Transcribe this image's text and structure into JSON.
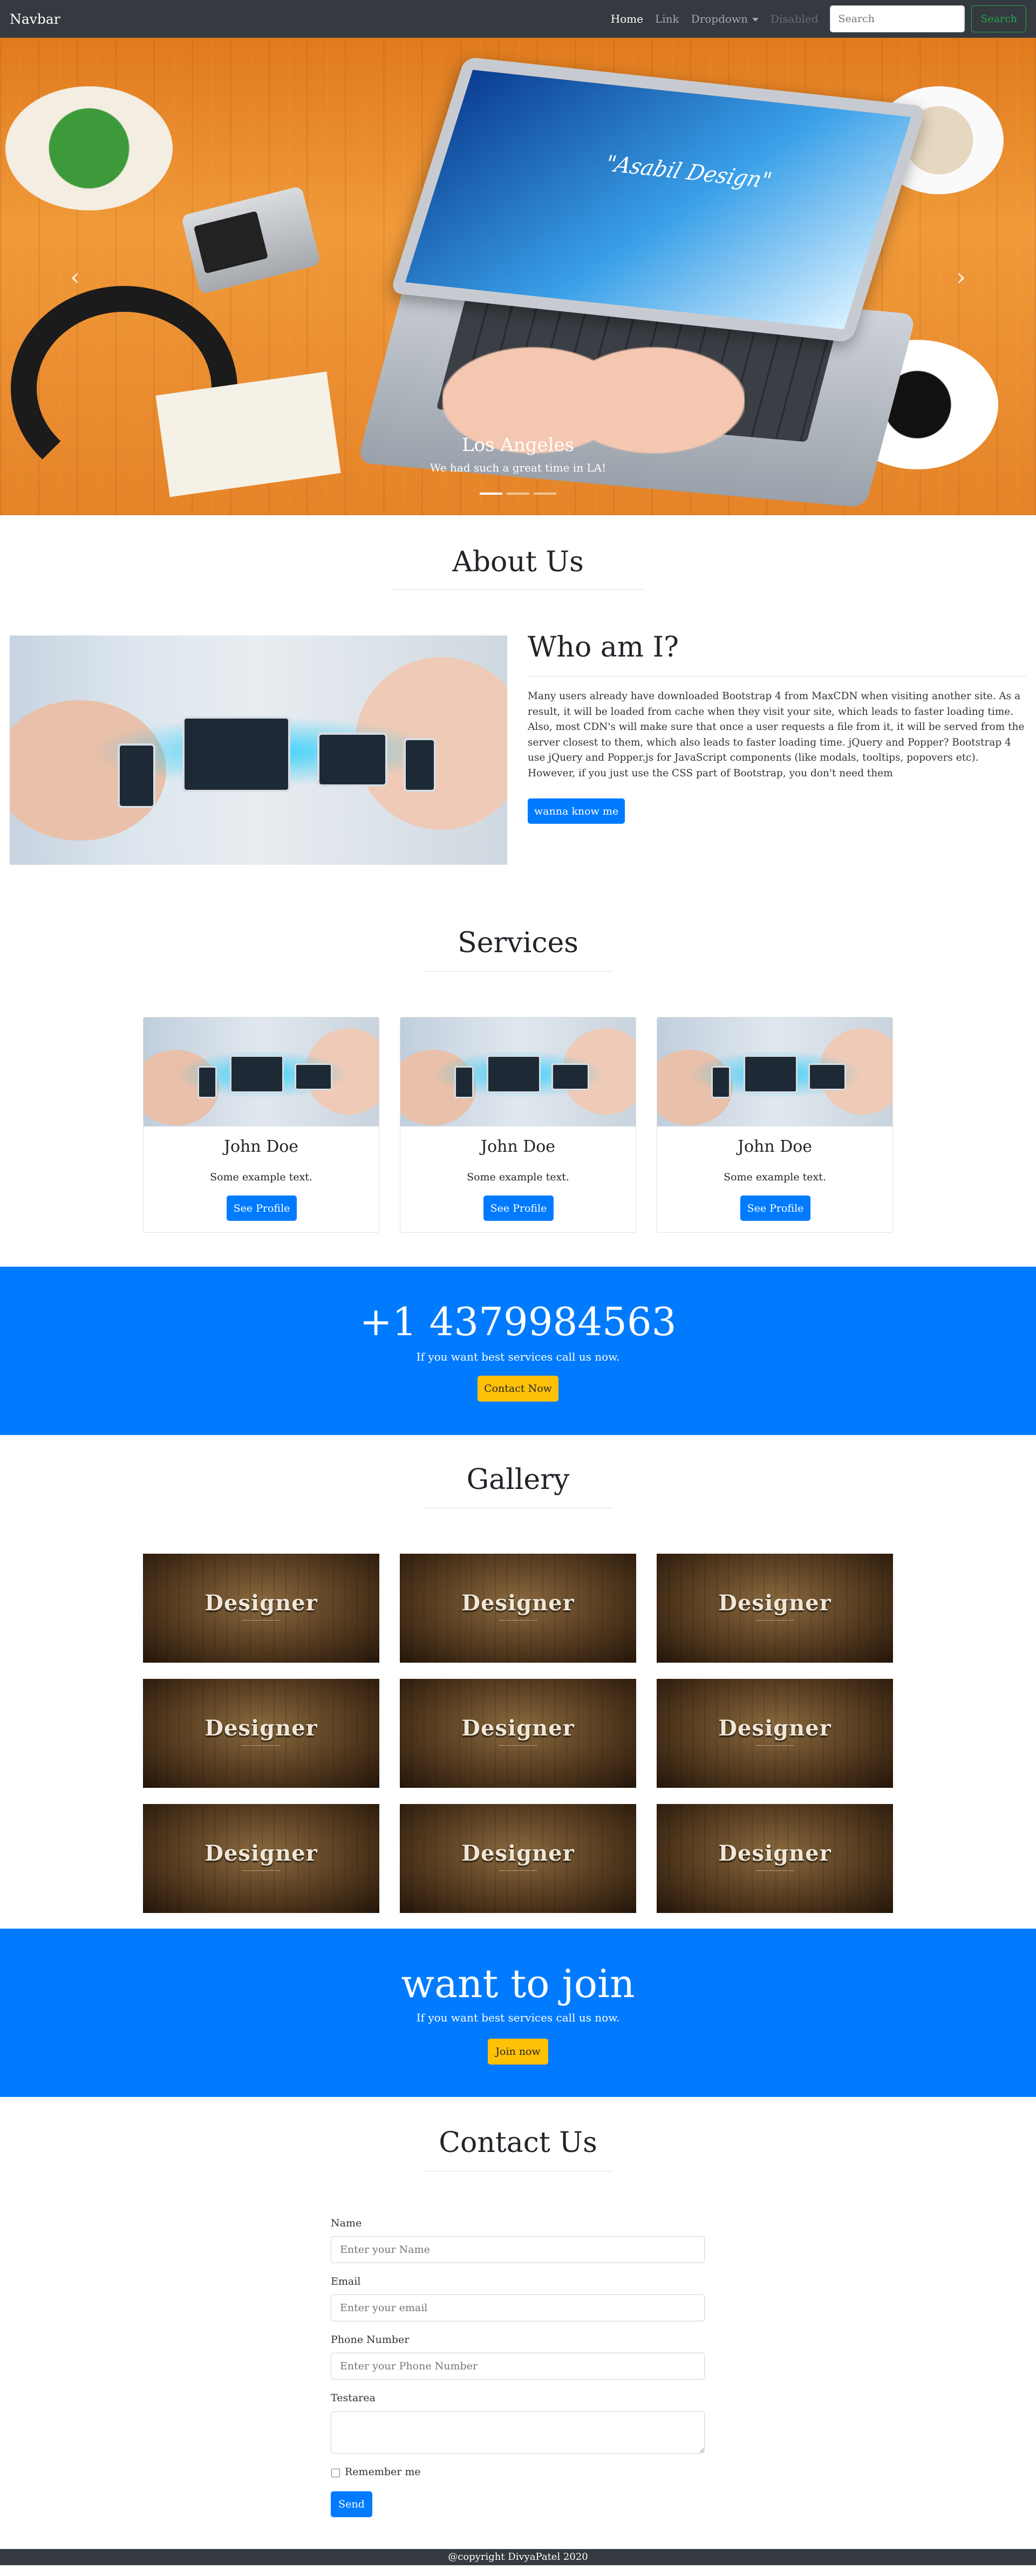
{
  "navbar": {
    "brand": "Navbar",
    "links": [
      "Home",
      "Link",
      "Dropdown",
      "Disabled"
    ],
    "search_placeholder": "Search",
    "search_button": "Search"
  },
  "carousel": {
    "laptop_text": "\"Asabil Design\"",
    "caption_title": "Los Angeles",
    "caption_text": "We had such a great time in LA!",
    "slide_count": 3,
    "active_slide": 1
  },
  "about": {
    "title": "About Us",
    "heading": "Who am I?",
    "text": "Many users already have downloaded Bootstrap 4 from MaxCDN when visiting another site. As a result, it will be loaded from cache when they visit your site, which leads to faster loading time. Also, most CDN's will make sure that once a user requests a file from it, it will be served from the server closest to them, which also leads to faster loading time. jQuery and Popper? Bootstrap 4 use jQuery and Popper.js for JavaScript components (like modals, tooltips, popovers etc). However, if you just use the CSS part of Bootstrap, you don't need them",
    "button": "wanna know me"
  },
  "services": {
    "title": "Services",
    "cards": [
      {
        "name": "John Doe",
        "text": "Some example text.",
        "button": "See Profile"
      },
      {
        "name": "John Doe",
        "text": "Some example text.",
        "button": "See Profile"
      },
      {
        "name": "John Doe",
        "text": "Some example text.",
        "button": "See Profile"
      }
    ]
  },
  "call": {
    "phone": "+1 4379984563",
    "subtitle": "If you want best services call us now.",
    "button": "Contact Now"
  },
  "gallery": {
    "title": "Gallery",
    "image_text": "Designer",
    "image_count": 9
  },
  "join": {
    "title": "want to join",
    "subtitle": "If you want best services call us now.",
    "button": "Join now"
  },
  "contact": {
    "title": "Contact Us",
    "name_label": "Name",
    "name_placeholder": "Enter your Name",
    "email_label": "Email",
    "email_placeholder": "Enter your email",
    "phone_label": "Phone Number",
    "phone_placeholder": "Enter your Phone Number",
    "textarea_label": "Testarea",
    "remember_label": "Remember me",
    "send_button": "Send"
  },
  "footer": {
    "text": "@copyright DivyaPatel 2020"
  },
  "colors": {
    "primary": "#007bff",
    "warning": "#ffc107",
    "dark": "#343a40",
    "success": "#28a745"
  }
}
